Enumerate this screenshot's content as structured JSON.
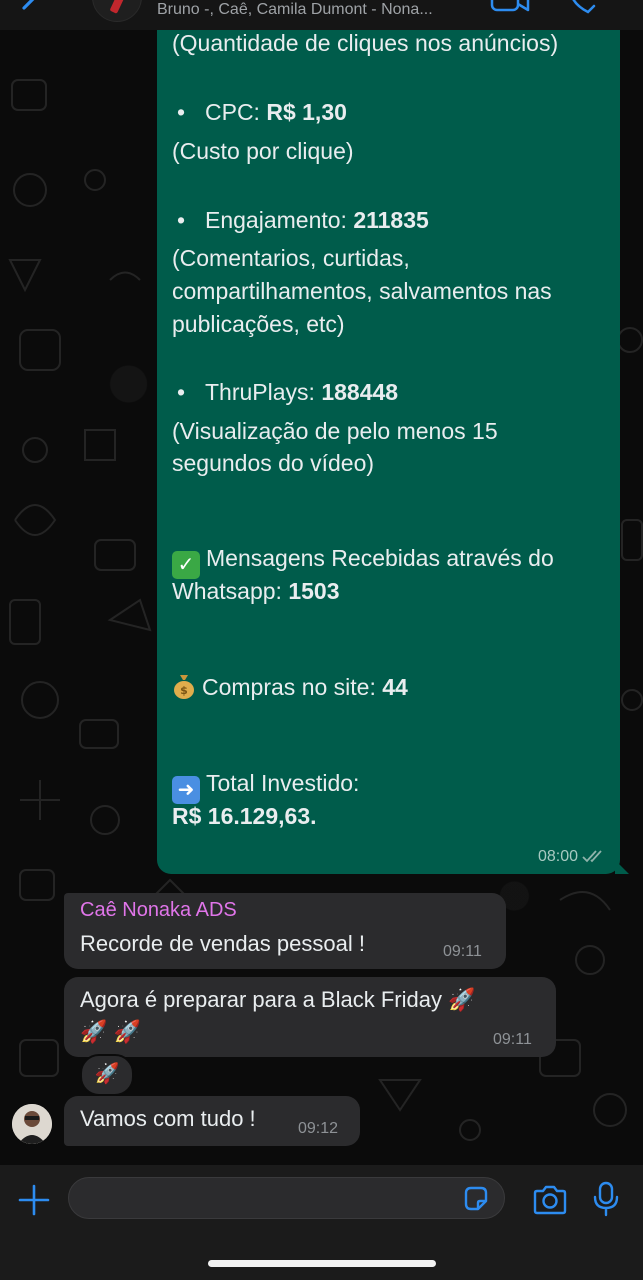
{
  "header": {
    "participants": "Bruno -, Caê, Camila Dumont - Nona..."
  },
  "outgoing_message": {
    "lines": {
      "l1": "(Quantidade de cliques nos anúncios)",
      "cpc_label": "CPC: ",
      "cpc_value": "R$ 1,30",
      "cpc_desc": "(Custo por clique)",
      "eng_label": "Engajamento: ",
      "eng_value": "211835",
      "eng_desc1": "(Comentarios, curtidas,",
      "eng_desc2": "compartilhamentos, salvamentos nas",
      "eng_desc3": "publicações, etc)",
      "thru_label": "ThruPlays: ",
      "thru_value": "188448",
      "thru_desc1": "(Visualização de pelo menos 15",
      "thru_desc2": "segundos do vídeo)",
      "msg_label1": "Mensagens Recebidas através do",
      "msg_label2": "Whatsapp: ",
      "msg_value": "1503",
      "compras_label": "Compras no site: ",
      "compras_value": "44",
      "total_label": "Total Investido:",
      "total_value": "R$ 16.129,63."
    },
    "bullet": "•",
    "time": "08:00",
    "status": "read"
  },
  "incoming_messages": [
    {
      "sender": "Caê Nonaka ADS",
      "text": "Recorde de vendas pessoal !",
      "time": "09:11"
    },
    {
      "text": "Agora é preparar para a Black Friday 🚀",
      "text2": "🚀 🚀",
      "time": "09:11",
      "reaction": "🚀"
    },
    {
      "text": "Vamos com tudo !",
      "time": "09:12"
    }
  ],
  "colors": {
    "outgoing_bubble": "#005c4b",
    "incoming_bubble": "#2b2b2d",
    "sender_name": "#e075e9",
    "accent_icons": "#2d8cf0"
  },
  "icons": [
    "back-icon",
    "video-call-icon",
    "voice-call-icon",
    "plus-icon",
    "sticker-icon",
    "camera-icon",
    "microphone-icon",
    "double-check-icon",
    "check-mark-emoji",
    "money-bag-emoji",
    "right-arrow-emoji",
    "rocket-emoji"
  ]
}
